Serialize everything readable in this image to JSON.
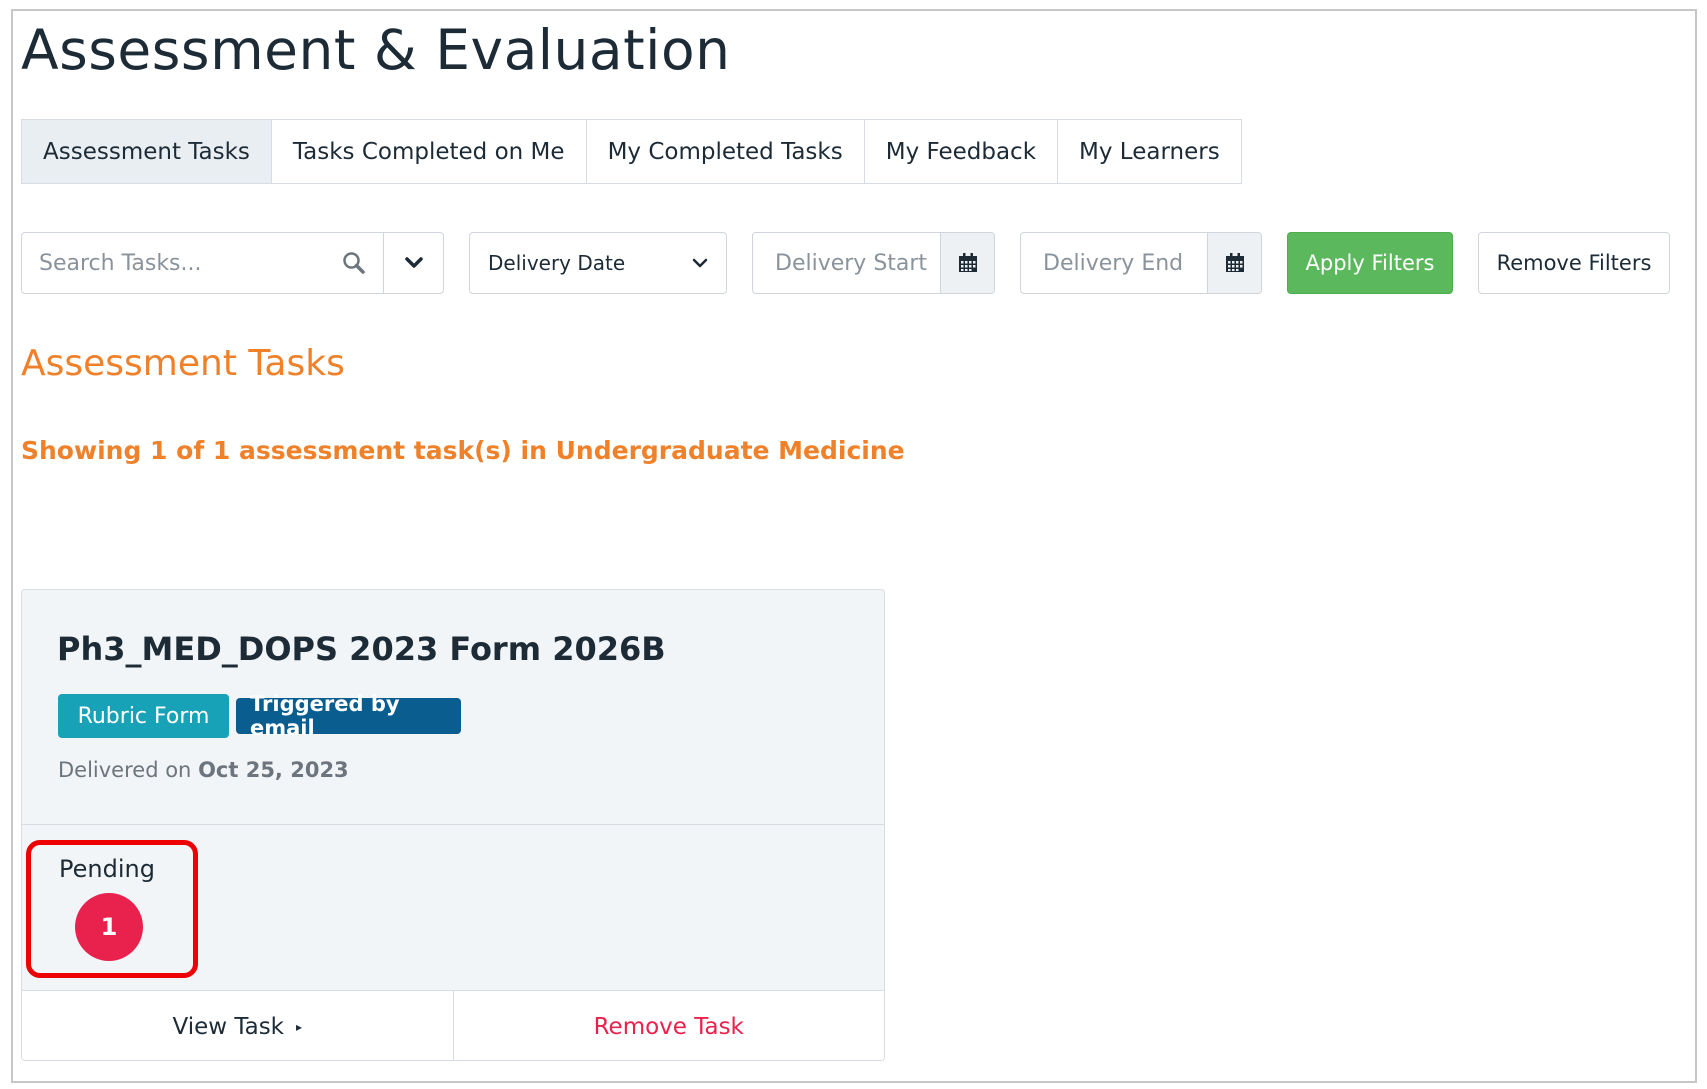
{
  "page": {
    "title": "Assessment & Evaluation"
  },
  "tabs": [
    {
      "label": "Assessment Tasks",
      "active": true
    },
    {
      "label": "Tasks Completed on Me",
      "active": false
    },
    {
      "label": "My Completed Tasks",
      "active": false
    },
    {
      "label": "My Feedback",
      "active": false
    },
    {
      "label": "My Learners",
      "active": false
    }
  ],
  "filters": {
    "search_placeholder": "Search Tasks...",
    "date_type_selected": "Delivery Date",
    "start_placeholder": "Delivery Start",
    "end_placeholder": "Delivery End",
    "apply_label": "Apply Filters",
    "remove_label": "Remove Filters"
  },
  "section": {
    "heading": "Assessment Tasks",
    "showing_text": "Showing 1 of 1 assessment task(s) in Undergraduate Medicine"
  },
  "task_card": {
    "title": "Ph3_MED_DOPS 2023 Form 2026B",
    "badges": [
      "Rubric Form",
      "Triggered by email"
    ],
    "delivered_prefix": "Delivered on",
    "delivered_date": "Oct 25, 2023",
    "status_label": "Pending",
    "status_count": "1",
    "view_label": "View Task",
    "remove_label": "Remove Task"
  },
  "colors": {
    "accent_orange": "#f0812b",
    "apply_green": "#5cb85c",
    "rubric_badge": "#17a2b8",
    "email_badge": "#0a5e8f",
    "pending_badge": "#e8224d",
    "highlight": "#ee0000"
  },
  "icons": {
    "search": "search-icon",
    "dropdown": "chevron-down-icon",
    "calendar": "calendar-icon",
    "view_caret": "caret-right-icon"
  }
}
